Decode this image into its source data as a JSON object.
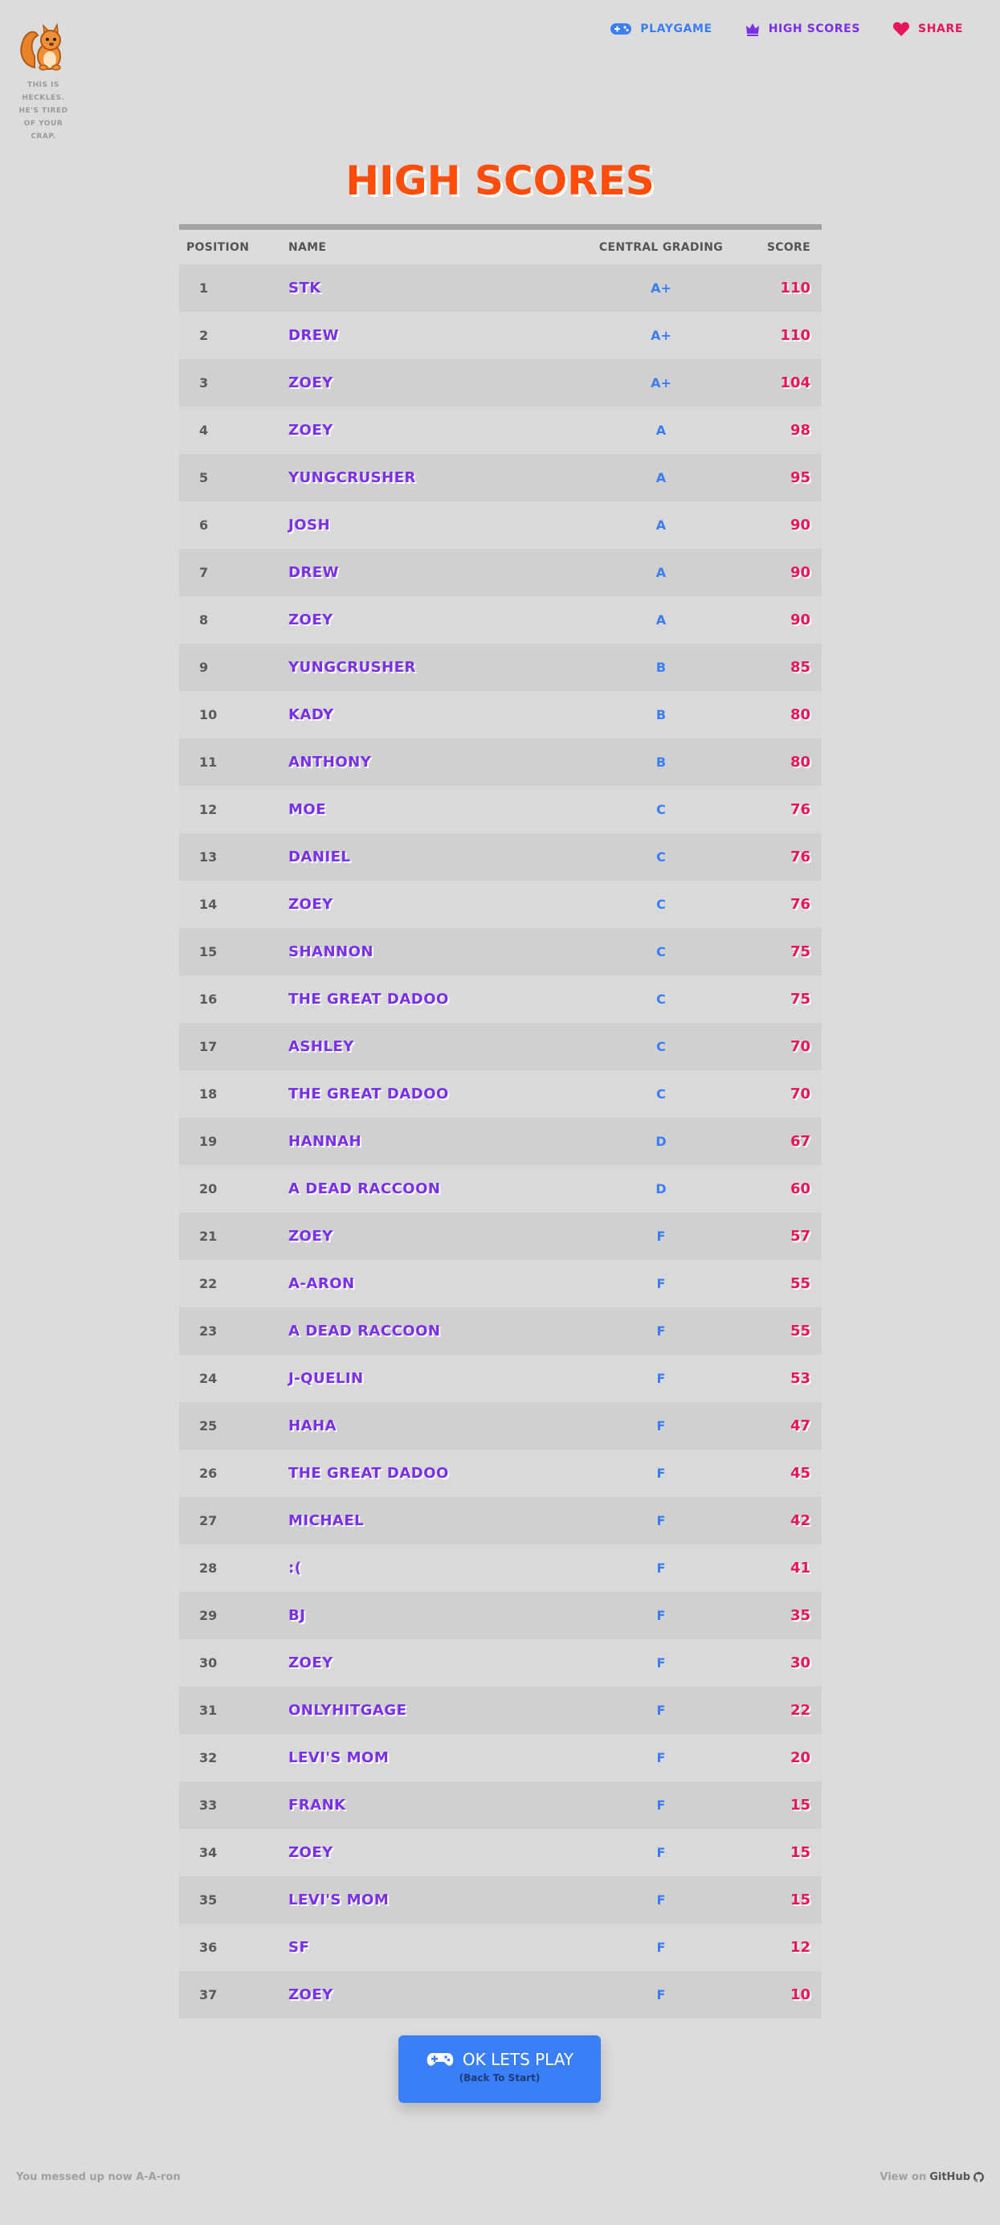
{
  "logo": {
    "tagline": [
      "THIS IS",
      "HECKLES.",
      "HE'S TIRED",
      "OF YOUR",
      "CRAP."
    ]
  },
  "nav": {
    "items": [
      {
        "label": "PLAYGAME",
        "icon": "gamepad-icon",
        "color": "#3b7df5"
      },
      {
        "label": "HIGH SCORES",
        "icon": "crown-icon",
        "color": "#7a2fe8"
      },
      {
        "label": "SHARE",
        "icon": "heart-icon",
        "color": "#e8155a"
      }
    ]
  },
  "page": {
    "title": "HIGH SCORES"
  },
  "table": {
    "headers": {
      "position": "POSITION",
      "name": "NAME",
      "grade": "CENTRAL GRADING",
      "score": "SCORE"
    },
    "rows": [
      {
        "position": "1",
        "name": "STK",
        "grade": "A+",
        "score": "110"
      },
      {
        "position": "2",
        "name": "DREW",
        "grade": "A+",
        "score": "110"
      },
      {
        "position": "3",
        "name": "ZOEY",
        "grade": "A+",
        "score": "104"
      },
      {
        "position": "4",
        "name": "ZOEY",
        "grade": "A",
        "score": "98"
      },
      {
        "position": "5",
        "name": "YUNGCRUSHER",
        "grade": "A",
        "score": "95"
      },
      {
        "position": "6",
        "name": "JOSH",
        "grade": "A",
        "score": "90"
      },
      {
        "position": "7",
        "name": "DREW",
        "grade": "A",
        "score": "90"
      },
      {
        "position": "8",
        "name": "ZOEY",
        "grade": "A",
        "score": "90"
      },
      {
        "position": "9",
        "name": "YUNGCRUSHER",
        "grade": "B",
        "score": "85"
      },
      {
        "position": "10",
        "name": "KADY",
        "grade": "B",
        "score": "80"
      },
      {
        "position": "11",
        "name": "ANTHONY",
        "grade": "B",
        "score": "80"
      },
      {
        "position": "12",
        "name": "MOE",
        "grade": "C",
        "score": "76"
      },
      {
        "position": "13",
        "name": "DANIEL",
        "grade": "C",
        "score": "76"
      },
      {
        "position": "14",
        "name": "ZOEY",
        "grade": "C",
        "score": "76"
      },
      {
        "position": "15",
        "name": "SHANNON",
        "grade": "C",
        "score": "75"
      },
      {
        "position": "16",
        "name": "THE GREAT DADOO",
        "grade": "C",
        "score": "75"
      },
      {
        "position": "17",
        "name": "ASHLEY",
        "grade": "C",
        "score": "70"
      },
      {
        "position": "18",
        "name": "THE GREAT DADOO",
        "grade": "C",
        "score": "70"
      },
      {
        "position": "19",
        "name": "HANNAH",
        "grade": "D",
        "score": "67"
      },
      {
        "position": "20",
        "name": "A DEAD RACCOON",
        "grade": "D",
        "score": "60"
      },
      {
        "position": "21",
        "name": "ZOEY",
        "grade": "F",
        "score": "57"
      },
      {
        "position": "22",
        "name": "A-ARON",
        "grade": "F",
        "score": "55"
      },
      {
        "position": "23",
        "name": "A DEAD RACCOON",
        "grade": "F",
        "score": "55"
      },
      {
        "position": "24",
        "name": "J-QUELIN",
        "grade": "F",
        "score": "53"
      },
      {
        "position": "25",
        "name": "HAHA",
        "grade": "F",
        "score": "47"
      },
      {
        "position": "26",
        "name": "THE GREAT DADOO",
        "grade": "F",
        "score": "45"
      },
      {
        "position": "27",
        "name": "MICHAEL",
        "grade": "F",
        "score": "42"
      },
      {
        "position": "28",
        "name": ":(",
        "grade": "F",
        "score": "41"
      },
      {
        "position": "29",
        "name": "BJ",
        "grade": "F",
        "score": "35"
      },
      {
        "position": "30",
        "name": "ZOEY",
        "grade": "F",
        "score": "30"
      },
      {
        "position": "31",
        "name": "ONLYHITGAGE",
        "grade": "F",
        "score": "22"
      },
      {
        "position": "32",
        "name": "LEVI'S MOM",
        "grade": "F",
        "score": "20"
      },
      {
        "position": "33",
        "name": "FRANK",
        "grade": "F",
        "score": "15"
      },
      {
        "position": "34",
        "name": "ZOEY",
        "grade": "F",
        "score": "15"
      },
      {
        "position": "35",
        "name": "LEVI'S MOM",
        "grade": "F",
        "score": "15"
      },
      {
        "position": "36",
        "name": "SF",
        "grade": "F",
        "score": "12"
      },
      {
        "position": "37",
        "name": "ZOEY",
        "grade": "F",
        "score": "10"
      }
    ]
  },
  "play_button": {
    "label": "OK LETS PLAY",
    "sublabel": "(Back To Start)",
    "icon": "gamepad-icon"
  },
  "footer": {
    "left": "You messed up now A-A-ron",
    "right_prefix": "View on",
    "right_link": "GitHub",
    "icon": "github-icon"
  },
  "colors": {
    "title": "#ff4d0c",
    "name": "#7a2fe8",
    "grade": "#3b7df5",
    "score": "#e8155a",
    "button": "#3a7ff7",
    "background": "#dcdcdc"
  }
}
